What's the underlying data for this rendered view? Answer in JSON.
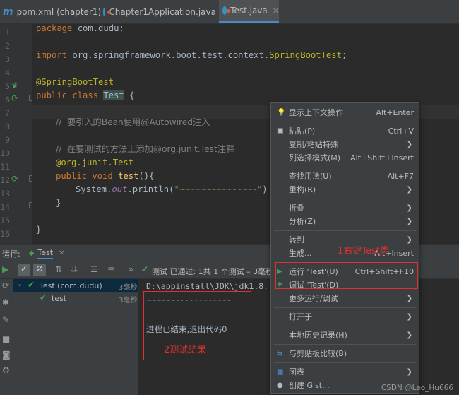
{
  "tabs": [
    {
      "label": "pom.xml (chapter1)",
      "icon": "m-maven-icon"
    },
    {
      "label": "Chapter1Application.java",
      "icon": "class-icon"
    },
    {
      "label": "Test.java",
      "icon": "class-icon",
      "active": true
    }
  ],
  "gutter_lines": [
    "1",
    "2",
    "3",
    "4",
    "5",
    "6",
    "7",
    "8",
    "9",
    "10",
    "11",
    "12",
    "13",
    "14",
    "15",
    "16"
  ],
  "code": {
    "l1_kw": "package",
    "l1_rest": " com.dudu;",
    "l3_kw": "import",
    "l3_rest": " org.springframework.boot.test.context.",
    "l3_ann": "SpringBootTest",
    "l3_end": ";",
    "l5_ann": "@SpringBootTest",
    "l6_kw": "public class ",
    "l6_class": "Test",
    "l6_rest": " {",
    "l8_comment": "//  要引入的Bean使用@Autowired注入",
    "l10_comment": "//  在要测试的方法上添加@org.junit.Test注释",
    "l11_ann": "@org.junit.Test",
    "l12_kw": "public void ",
    "l12_fn": "test",
    "l12_rest": "(){",
    "l13_pre": "System.",
    "l13_out": "out",
    "l13_mid": ".println(",
    "l13_str": "\"~~~~~~~~~~~~~~~\"",
    "l13_end": ")",
    "l14_brace": "}",
    "l16_brace": "}"
  },
  "run_panel": {
    "label": "运行:",
    "tab": "Test",
    "status": "测试 已通过: 1共 1 个测试 – 3毫秒",
    "tree_root": "Test (com.dudu)",
    "tree_root_time": "3毫秒",
    "tree_child": "test",
    "tree_child_time": "3毫秒",
    "console_path": "D:\\appinstall\\JDK\\jdk1.8.",
    "console_tilde": "~~~~~~~~~~~~~~~~~~",
    "console_exit": "进程已结束,退出代码0"
  },
  "context_menu": [
    {
      "label": "显示上下文操作",
      "shortcut": "Alt+Enter",
      "icon": "bulb-icon"
    },
    {
      "label": "粘贴(P)",
      "shortcut": "Ctrl+V",
      "icon": "clipboard-icon"
    },
    {
      "label": "复制/粘贴特殊",
      "submenu": true
    },
    {
      "label": "列选择模式(M)",
      "shortcut": "Alt+Shift+Insert"
    },
    {
      "label": "查找用法(U)",
      "shortcut": "Alt+F7"
    },
    {
      "label": "重构(R)",
      "submenu": true
    },
    {
      "label": "折叠",
      "submenu": true
    },
    {
      "label": "分析(Z)",
      "submenu": true
    },
    {
      "label": "转到",
      "submenu": true
    },
    {
      "label": "生成...",
      "shortcut": "Alt+Insert"
    },
    {
      "label": "运行 'Test'(U)",
      "shortcut": "Ctrl+Shift+F10",
      "icon": "run-icon"
    },
    {
      "label": "调试 'Test'(D)",
      "icon": "debug-icon"
    },
    {
      "label": "更多运行/调试",
      "submenu": true
    },
    {
      "label": "打开于",
      "submenu": true
    },
    {
      "label": "本地历史记录(H)",
      "submenu": true
    },
    {
      "label": "与剪贴板比较(B)",
      "icon": "compare-icon"
    },
    {
      "label": "图表",
      "submenu": true,
      "icon": "diagram-icon"
    },
    {
      "label": "创建 Gist...",
      "icon": "github-icon"
    }
  ],
  "annotations": {
    "note1": "1右键Test类",
    "note2": "2测试结果"
  },
  "watermark": "CSDN @Leo_Hu666",
  "colors": {
    "keyword": "#cc7832",
    "annotation": "#bbb529",
    "comment": "#808080",
    "string": "#6a8759",
    "accent": "#4a88c7",
    "highlight": "#e03131"
  }
}
